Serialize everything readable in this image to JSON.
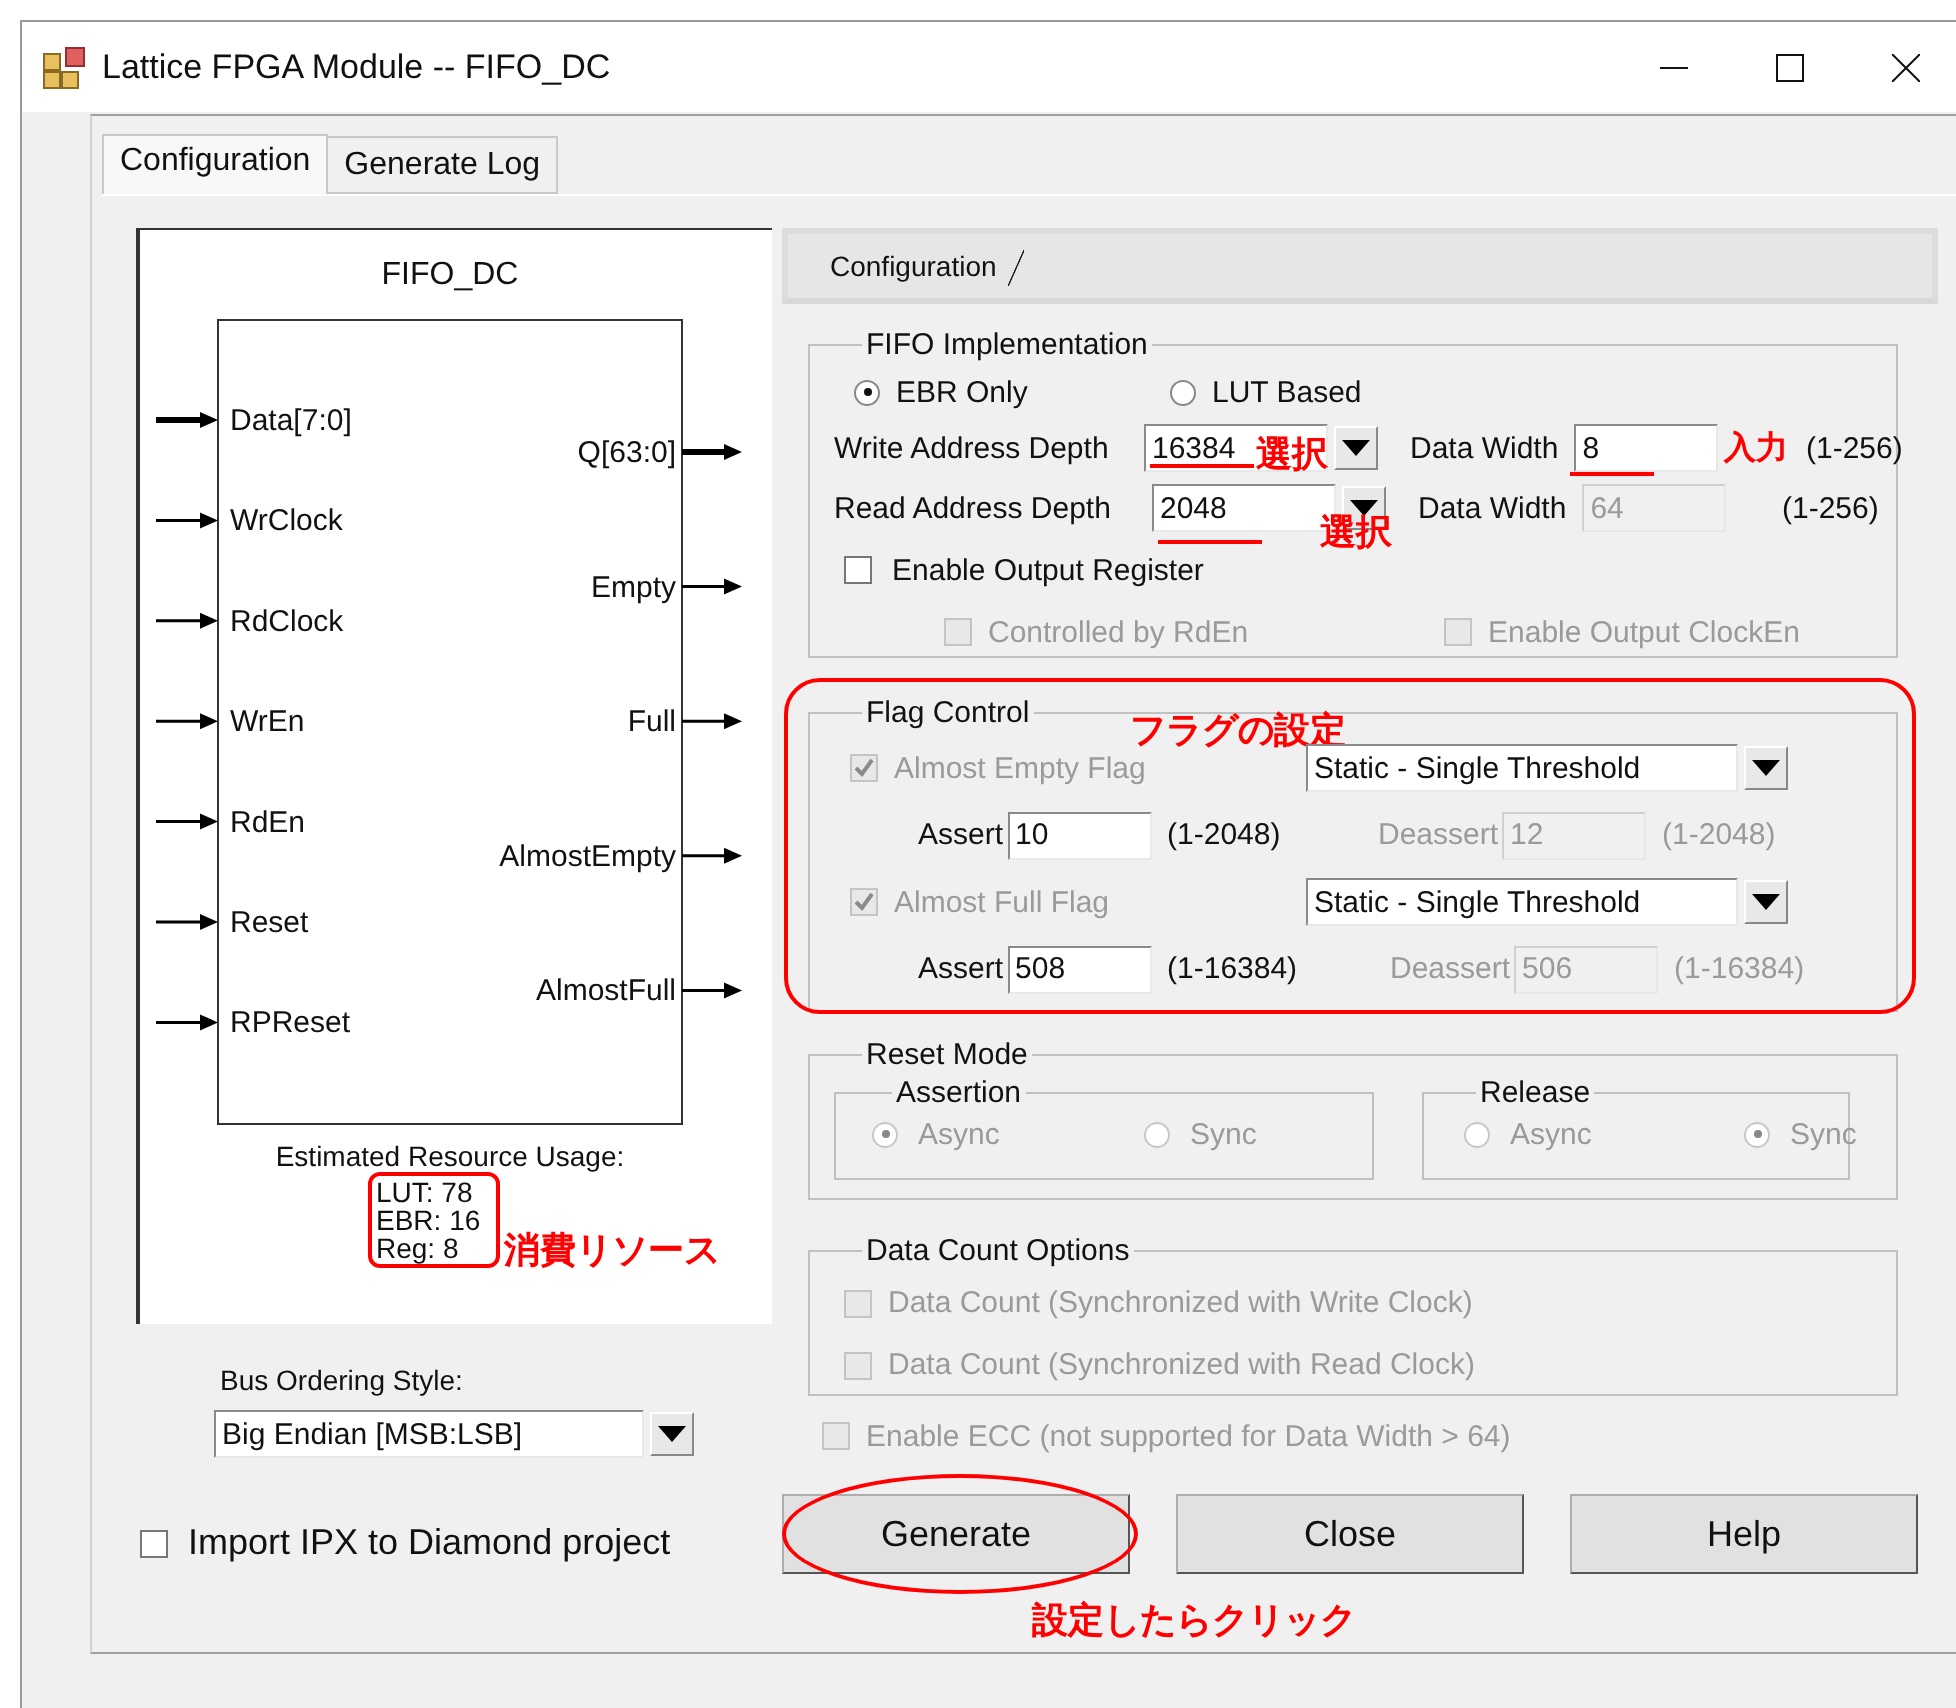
{
  "window": {
    "title": "Lattice FPGA Module -- FIFO_DC"
  },
  "tabs": [
    {
      "label": "Configuration",
      "selected": true
    },
    {
      "label": "Generate Log",
      "selected": false
    }
  ],
  "diagram": {
    "title": "FIFO_DC",
    "inputs": [
      {
        "name": "Data[7:0]",
        "bus": true
      },
      {
        "name": "WrClock",
        "bus": false
      },
      {
        "name": "RdClock",
        "bus": false
      },
      {
        "name": "WrEn",
        "bus": false
      },
      {
        "name": "RdEn",
        "bus": false
      },
      {
        "name": "Reset",
        "bus": false
      },
      {
        "name": "RPReset",
        "bus": false
      }
    ],
    "outputs": [
      {
        "name": "Q[63:0]",
        "bus": true
      },
      {
        "name": "Empty",
        "bus": false
      },
      {
        "name": "Full",
        "bus": false
      },
      {
        "name": "AlmostEmpty",
        "bus": false
      },
      {
        "name": "AlmostFull",
        "bus": false
      }
    ],
    "usage_title": "Estimated Resource Usage:",
    "usage": [
      "LUT: 78",
      "EBR: 16",
      "Reg: 8"
    ],
    "usage_note": "消費リソース"
  },
  "bus_ordering": {
    "label": "Bus Ordering Style:",
    "value": "Big Endian [MSB:LSB]"
  },
  "import_ipx": {
    "label": "Import IPX to Diamond project",
    "checked": false
  },
  "config_tab": {
    "label": "Configuration"
  },
  "fifo_impl": {
    "title": "FIFO Implementation",
    "radios": [
      {
        "label": "EBR Only",
        "selected": true
      },
      {
        "label": "LUT Based",
        "selected": false
      }
    ],
    "rows": [
      {
        "label": "Write Address Depth",
        "value": "16384",
        "note": "選択",
        "width_label": "Data Width",
        "width_value": "8",
        "width_disabled": false,
        "width_note": "入力",
        "range": "(1-256)"
      },
      {
        "label": "Read Address Depth",
        "value": "2048",
        "note": "選択",
        "width_label": "Data Width",
        "width_value": "64",
        "width_disabled": true,
        "range": "(1-256)"
      }
    ],
    "output_register": {
      "label": "Enable Output Register",
      "checked": false
    },
    "sub_options": [
      {
        "label": "Controlled by RdEn",
        "checked": false,
        "disabled": true
      },
      {
        "label": "Enable Output ClockEn",
        "checked": false,
        "disabled": true
      }
    ]
  },
  "flag_control": {
    "title": "Flag Control",
    "note": "フラグの設定",
    "flags": [
      {
        "label": "Almost Empty Flag",
        "checked": true,
        "disabled": true,
        "mode": "Static - Single Threshold",
        "assert_label": "Assert",
        "assert_value": "10",
        "assert_range": "(1-2048)",
        "deassert_label": "Deassert",
        "deassert_value": "12",
        "deassert_range": "(1-2048)"
      },
      {
        "label": "Almost Full Flag",
        "checked": true,
        "disabled": true,
        "mode": "Static - Single Threshold",
        "assert_label": "Assert",
        "assert_value": "508",
        "assert_range": "(1-16384)",
        "deassert_label": "Deassert",
        "deassert_value": "506",
        "deassert_range": "(1-16384)"
      }
    ]
  },
  "reset_mode": {
    "title": "Reset Mode",
    "groups": [
      {
        "title": "Assertion",
        "options": [
          {
            "label": "Async",
            "selected": true,
            "disabled": true
          },
          {
            "label": "Sync",
            "selected": false,
            "disabled": true
          }
        ]
      },
      {
        "title": "Release",
        "options": [
          {
            "label": "Async",
            "selected": false,
            "disabled": true
          },
          {
            "label": "Sync",
            "selected": true,
            "disabled": true
          }
        ]
      }
    ]
  },
  "data_count": {
    "title": "Data Count Options",
    "options": [
      {
        "label": "Data Count (Synchronized with Write Clock)",
        "checked": false,
        "disabled": true
      },
      {
        "label": "Data Count (Synchronized with Read Clock)",
        "checked": false,
        "disabled": true
      }
    ]
  },
  "ecc": {
    "label": "Enable ECC (not supported for Data Width > 64)",
    "checked": false,
    "disabled": true
  },
  "buttons": [
    {
      "label": "Generate",
      "note": "設定したらクリック"
    },
    {
      "label": "Close"
    },
    {
      "label": "Help"
    }
  ]
}
